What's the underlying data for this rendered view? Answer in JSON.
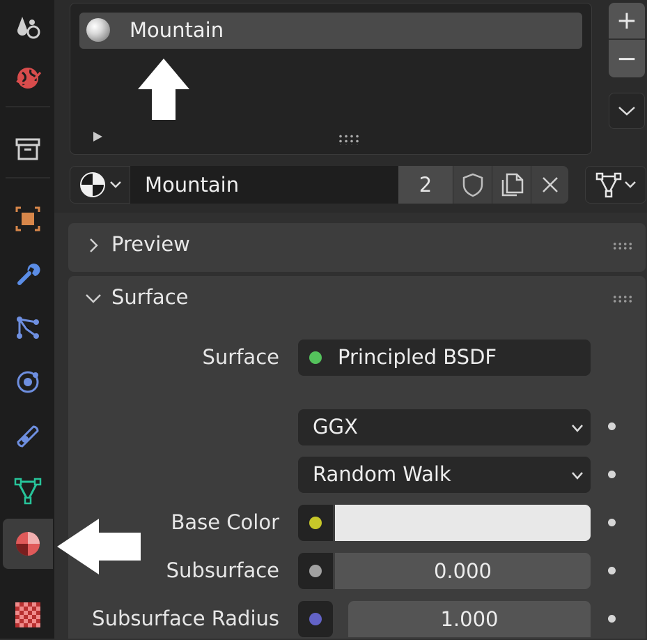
{
  "material_slots": {
    "items": [
      {
        "name": "Mountain"
      }
    ],
    "add_label": "+",
    "remove_label": "−"
  },
  "datablock": {
    "name": "Mountain",
    "users": "2"
  },
  "panels": {
    "preview_title": "Preview",
    "surface_title": "Surface"
  },
  "surface": {
    "surface_label": "Surface",
    "surface_value": "Principled BSDF",
    "distribution": "GGX",
    "subsurface_method": "Random Walk",
    "base_color_label": "Base Color",
    "base_color": "#e8e8e8",
    "subsurface_label": "Subsurface",
    "subsurface_value": "0.000",
    "subsurface_radius_label": "Subsurface Radius",
    "subsurface_radius_value": "1.000"
  },
  "colors": {
    "socket_shader": "#54c25c",
    "socket_color": "#c7c729",
    "socket_float": "#a1a1a1",
    "socket_vector": "#6363c7"
  },
  "tabs": [
    "tool-icon",
    "world-icon",
    "collection-icon",
    "object-icon",
    "modifier-icon",
    "particles-icon",
    "physics-icon",
    "constraints-icon",
    "object-data-icon",
    "material-icon",
    "texture-icon"
  ]
}
